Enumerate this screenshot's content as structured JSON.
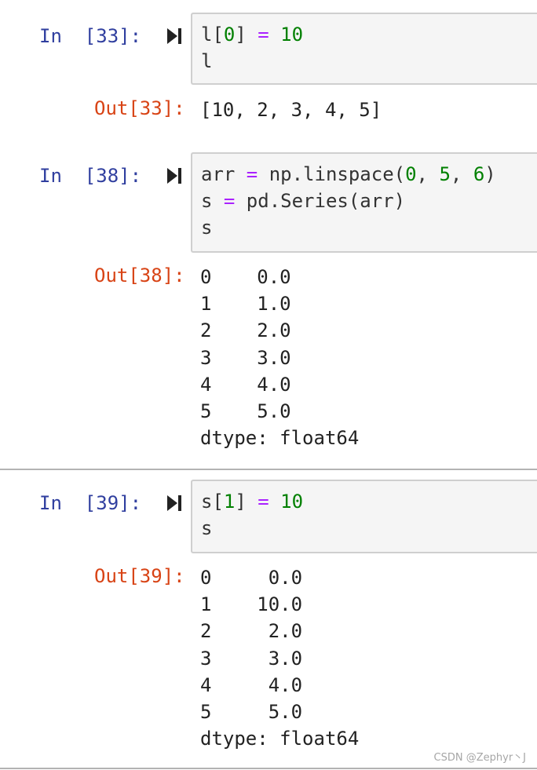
{
  "cells": [
    {
      "in_prompt": "In  [33]:",
      "code": [
        [
          [
            "l[",
            "txt"
          ],
          [
            "0",
            "num"
          ],
          [
            "] ",
            "txt"
          ],
          [
            "=",
            "op"
          ],
          [
            " ",
            "txt"
          ],
          [
            "10",
            "num"
          ]
        ],
        [
          [
            "l",
            "txt"
          ]
        ]
      ],
      "out_prompt": "Out[33]:",
      "output": "[10, 2, 3, 4, 5]"
    },
    {
      "in_prompt": "In  [38]:",
      "code": [
        [
          [
            "arr ",
            "txt"
          ],
          [
            "=",
            "op"
          ],
          [
            " np.linspace(",
            "txt"
          ],
          [
            "0",
            "num"
          ],
          [
            ", ",
            "txt"
          ],
          [
            "5",
            "num"
          ],
          [
            ", ",
            "txt"
          ],
          [
            "6",
            "num"
          ],
          [
            ")",
            "txt"
          ]
        ],
        [
          [
            "s ",
            "txt"
          ],
          [
            "=",
            "op"
          ],
          [
            " pd.Series(arr)",
            "txt"
          ]
        ],
        [
          [
            "s",
            "txt"
          ]
        ]
      ],
      "out_prompt": "Out[38]:",
      "output": "0    0.0\n1    1.0\n2    2.0\n3    3.0\n4    4.0\n5    5.0\ndtype: float64"
    },
    {
      "in_prompt": "In  [39]:",
      "code": [
        [
          [
            "s[",
            "txt"
          ],
          [
            "1",
            "num"
          ],
          [
            "] ",
            "txt"
          ],
          [
            "=",
            "op"
          ],
          [
            " ",
            "txt"
          ],
          [
            "10",
            "num"
          ]
        ],
        [
          [
            "s",
            "txt"
          ]
        ]
      ],
      "out_prompt": "Out[39]:",
      "output": "0     0.0\n1    10.0\n2     2.0\n3     3.0\n4     4.0\n5     5.0\ndtype: float64"
    }
  ],
  "watermark": "CSDN @Zephyr丶J",
  "icons": {
    "run": "run-cell-icon"
  },
  "colors": {
    "in_prompt": "#303f9f",
    "out_prompt": "#d84315",
    "number": "#008000",
    "operator": "#aa22ff",
    "input_bg": "#f5f5f5",
    "input_border": "#cfcfcf"
  }
}
